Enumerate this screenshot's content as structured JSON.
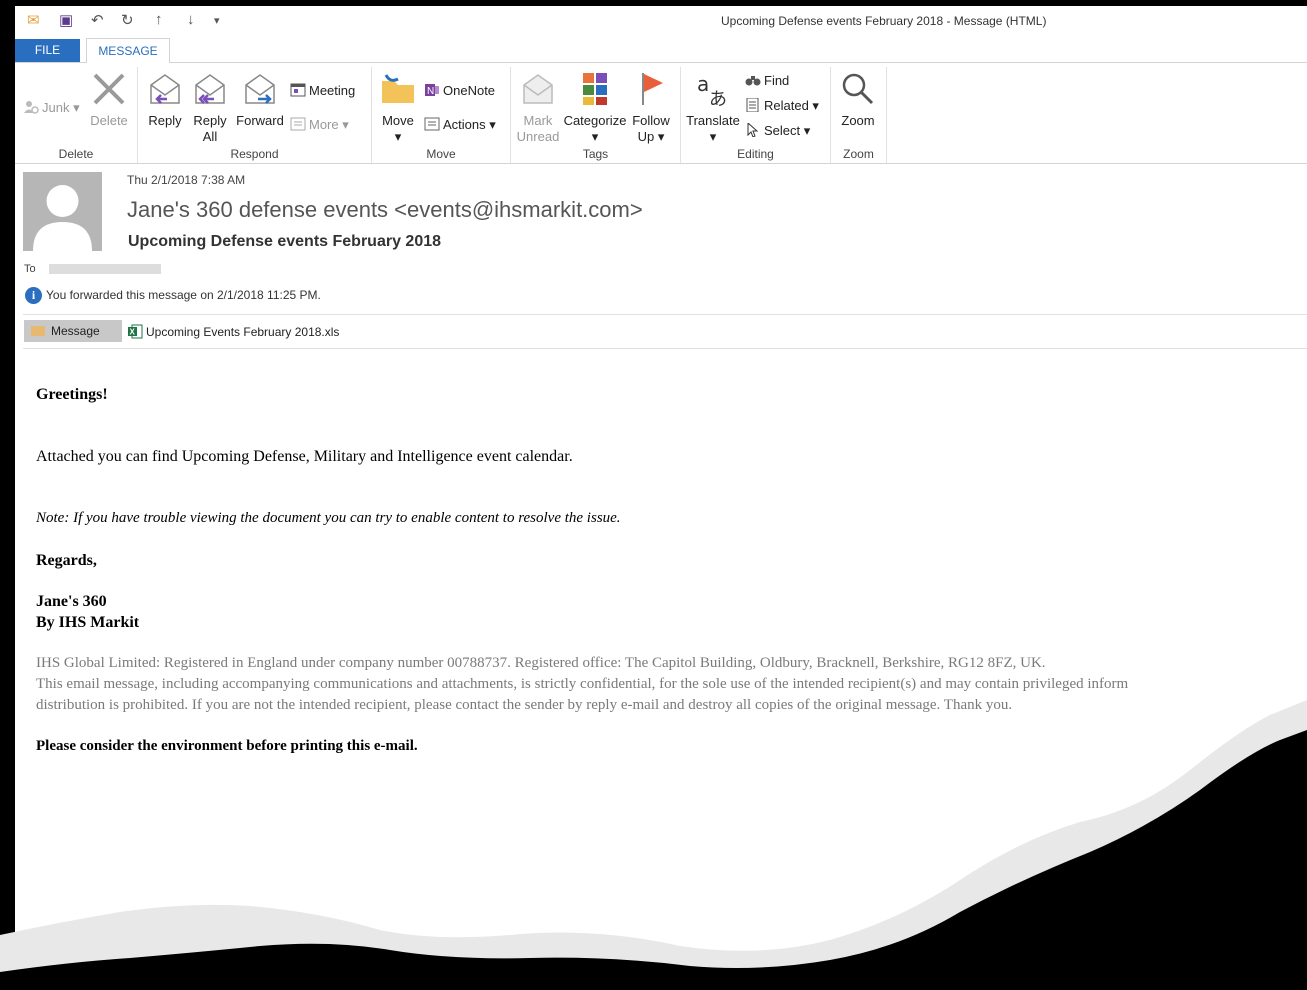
{
  "window": {
    "title": "Upcoming Defense events February 2018 - Message (HTML)"
  },
  "tabs": {
    "file": "FILE",
    "message": "MESSAGE"
  },
  "ribbon": {
    "delete": {
      "junk": "Junk",
      "delete": "Delete",
      "label": "Delete"
    },
    "respond": {
      "reply": "Reply",
      "reply_all_1": "Reply",
      "reply_all_2": "All",
      "forward": "Forward",
      "meeting": "Meeting",
      "more": "More",
      "label": "Respond"
    },
    "move": {
      "move": "Move",
      "onenote": "OneNote",
      "actions": "Actions",
      "label": "Move"
    },
    "tags": {
      "mark_1": "Mark",
      "mark_2": "Unread",
      "categorize": "Categorize",
      "follow_1": "Follow",
      "follow_2": "Up",
      "label": "Tags"
    },
    "editing": {
      "translate": "Translate",
      "find": "Find",
      "related": "Related",
      "select": "Select",
      "label": "Editing"
    },
    "zoom": {
      "zoom": "Zoom",
      "label": "Zoom"
    }
  },
  "header": {
    "date": "Thu 2/1/2018 7:38 AM",
    "from": "Jane's 360 defense events <events@ihsmarkit.com>",
    "subject": "Upcoming Defense events February 2018",
    "to_label": "To",
    "info": "You forwarded this message on 2/1/2018 11:25 PM."
  },
  "attachments": {
    "message_tab": "Message",
    "file": "Upcoming Events February 2018.xls"
  },
  "body": {
    "greeting": "Greetings!",
    "line1": "Attached you can find Upcoming Defense, Military and Intelligence event calendar.",
    "note": "Note: If you have trouble viewing the document you can try to enable content to resolve the issue.",
    "regards": "Regards,",
    "sig1": "Jane's 360",
    "sig2": "By IHS Markit",
    "legal1": "IHS Global Limited: Registered in England under company number 00788737. Registered office: The Capitol Building, Oldbury, Bracknell, Berkshire, RG12 8FZ, UK.",
    "legal2": "This email message, including accompanying communications and attachments, is strictly confidential, for the sole use of the intended recipient(s) and may contain privileged inform",
    "legal3": "distribution is prohibited. If you are not the intended recipient, please contact the sender by reply e-mail and destroy all copies of the original message. Thank you.",
    "env": "Please consider the environment before printing this e-mail."
  },
  "colors": {
    "accent": "#2a6ebf",
    "legal_gray": "#7a7a7a"
  }
}
